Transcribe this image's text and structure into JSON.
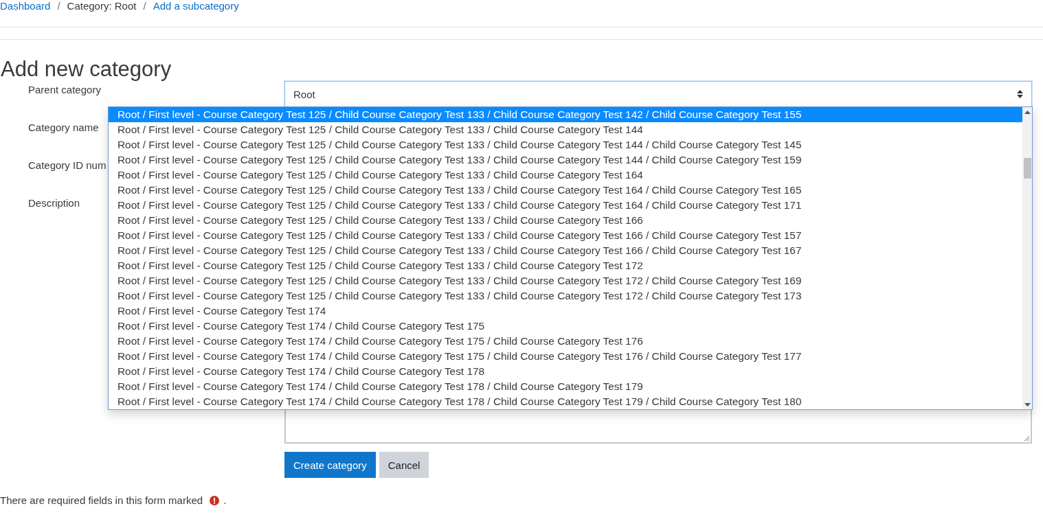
{
  "breadcrumb": [
    {
      "label": "Dashboard",
      "kind": "link"
    },
    {
      "label": "/",
      "kind": "separator"
    },
    {
      "label": "Category: Root",
      "kind": "text"
    },
    {
      "label": "/",
      "kind": "separator"
    },
    {
      "label": "Add a subcategory",
      "kind": "link"
    }
  ],
  "heading": "Add new category",
  "form": {
    "fields": [
      {
        "label": "Parent category",
        "kind": "select",
        "value": "Root"
      },
      {
        "label": "Category name",
        "kind": "text"
      },
      {
        "label": "Category ID num",
        "kind": "text"
      },
      {
        "label": "Description",
        "kind": "editor"
      }
    ],
    "dropdown_options": [
      {
        "label": "Root / First level - Course Category Test 125 / Child Course Category Test 133 / Child Course Category Test 142 / Child Course Category Test 155",
        "selected": true
      },
      {
        "label": "Root / First level - Course Category Test 125 / Child Course Category Test 133 / Child Course Category Test 144",
        "selected": false
      },
      {
        "label": "Root / First level - Course Category Test 125 / Child Course Category Test 133 / Child Course Category Test 144 / Child Course Category Test 145",
        "selected": false
      },
      {
        "label": "Root / First level - Course Category Test 125 / Child Course Category Test 133 / Child Course Category Test 144 / Child Course Category Test 159",
        "selected": false
      },
      {
        "label": "Root / First level - Course Category Test 125 / Child Course Category Test 133 / Child Course Category Test 164",
        "selected": false
      },
      {
        "label": "Root / First level - Course Category Test 125 / Child Course Category Test 133 / Child Course Category Test 164 / Child Course Category Test 165",
        "selected": false
      },
      {
        "label": "Root / First level - Course Category Test 125 / Child Course Category Test 133 / Child Course Category Test 164 / Child Course Category Test 171",
        "selected": false
      },
      {
        "label": "Root / First level - Course Category Test 125 / Child Course Category Test 133 / Child Course Category Test 166",
        "selected": false
      },
      {
        "label": "Root / First level - Course Category Test 125 / Child Course Category Test 133 / Child Course Category Test 166 / Child Course Category Test 157",
        "selected": false
      },
      {
        "label": "Root / First level - Course Category Test 125 / Child Course Category Test 133 / Child Course Category Test 166 / Child Course Category Test 167",
        "selected": false
      },
      {
        "label": "Root / First level - Course Category Test 125 / Child Course Category Test 133 / Child Course Category Test 172",
        "selected": false
      },
      {
        "label": "Root / First level - Course Category Test 125 / Child Course Category Test 133 / Child Course Category Test 172 / Child Course Category Test 169",
        "selected": false
      },
      {
        "label": "Root / First level - Course Category Test 125 / Child Course Category Test 133 / Child Course Category Test 172 / Child Course Category Test 173",
        "selected": false
      },
      {
        "label": "Root / First level - Course Category Test 174",
        "selected": false
      },
      {
        "label": "Root / First level - Course Category Test 174 / Child Course Category Test 175",
        "selected": false
      },
      {
        "label": "Root / First level - Course Category Test 174 / Child Course Category Test 175 / Child Course Category Test 176",
        "selected": false
      },
      {
        "label": "Root / First level - Course Category Test 174 / Child Course Category Test 175 / Child Course Category Test 176 / Child Course Category Test 177",
        "selected": false
      },
      {
        "label": "Root / First level - Course Category Test 174 / Child Course Category Test 178",
        "selected": false
      },
      {
        "label": "Root / First level - Course Category Test 174 / Child Course Category Test 178 / Child Course Category Test 179",
        "selected": false
      },
      {
        "label": "Root / First level - Course Category Test 174 / Child Course Category Test 178 / Child Course Category Test 179 / Child Course Category Test 180",
        "selected": false
      }
    ],
    "buttons": [
      {
        "label": "Create category",
        "kind": "primary"
      },
      {
        "label": "Cancel",
        "kind": "secondary"
      }
    ],
    "required_note": {
      "before": "There are required fields in this form marked",
      "after": "."
    }
  }
}
